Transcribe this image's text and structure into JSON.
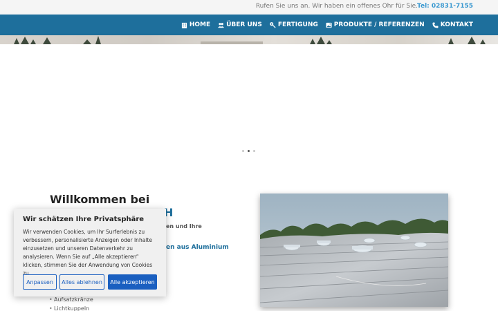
{
  "topbar": {
    "note": "Rufen Sie uns an. Wir haben ein offenes Ohr für Sie.",
    "tel": "Tel: 02831-7155"
  },
  "nav": {
    "items": [
      {
        "label": "HOME",
        "icon": "building-icon"
      },
      {
        "label": "ÜBER UNS",
        "icon": "users-icon"
      },
      {
        "label": "FERTIGUNG",
        "icon": "wrench-icon"
      },
      {
        "label": "PRODUKTE / REFERENZEN",
        "icon": "image-icon"
      },
      {
        "label": "KONTAKT",
        "icon": "phone-icon"
      }
    ]
  },
  "slider": {
    "dots": 3,
    "active_index": 1
  },
  "content": {
    "welcome": "Willkommen bei",
    "company_visible": "H",
    "lead_visible": "en und Ihre",
    "sub_visible": "en aus Aluminium für",
    "list": [
      "Aufsatzkränze",
      "Lichtkuppeln"
    ]
  },
  "cookie": {
    "title": "Wir schätzen Ihre Privatsphäre",
    "text": "Wir verwenden Cookies, um Ihr Surferlebnis zu verbessern, personalisierte Anzeigen oder Inhalte einzusetzen und unseren Datenverkehr zu analysieren. Wenn Sie auf „Alle akzeptieren“ klicken, stimmen Sie der Anwendung von Cookies zu.",
    "buttons": {
      "customize": "Anpassen",
      "reject": "Alles ablehnen",
      "accept": "Alle akzeptieren"
    }
  },
  "colors": {
    "navbar": "#1e6f9c",
    "tel": "#3a98d0",
    "accent_text": "#1e6f9c",
    "cookie_button": "#1a5fc0"
  }
}
